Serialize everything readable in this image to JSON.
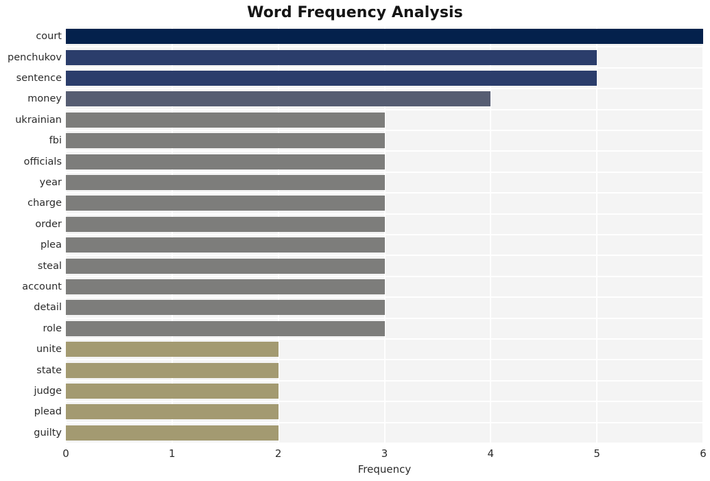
{
  "chart_data": {
    "type": "bar",
    "orientation": "horizontal",
    "title": "Word Frequency Analysis",
    "xlabel": "Frequency",
    "ylabel": "",
    "categories": [
      "court",
      "penchukov",
      "sentence",
      "money",
      "ukrainian",
      "fbi",
      "officials",
      "year",
      "charge",
      "order",
      "plea",
      "steal",
      "account",
      "detail",
      "role",
      "unite",
      "state",
      "judge",
      "plead",
      "guilty"
    ],
    "values": [
      6,
      5,
      5,
      4,
      3,
      3,
      3,
      3,
      3,
      3,
      3,
      3,
      3,
      3,
      3,
      2,
      2,
      2,
      2,
      2
    ],
    "bar_colors": [
      "#04214c",
      "#2b3d6b",
      "#2b3d6b",
      "#565d72",
      "#7d7d7b",
      "#7d7d7b",
      "#7d7d7b",
      "#7d7d7b",
      "#7d7d7b",
      "#7d7d7b",
      "#7d7d7b",
      "#7d7d7b",
      "#7d7d7b",
      "#7d7d7b",
      "#7d7d7b",
      "#a39a71",
      "#a39a71",
      "#a39a71",
      "#a39a71",
      "#a39a71"
    ],
    "xticks": [
      0,
      1,
      2,
      3,
      4,
      5,
      6
    ],
    "xtick_labels": [
      "0",
      "1",
      "2",
      "3",
      "4",
      "5",
      "6"
    ],
    "xlim": [
      0,
      6
    ],
    "grid": true,
    "legend": false,
    "plot_background": "#f4f4f4",
    "grid_color": "#ffffff",
    "figure_background": "#ffffff"
  }
}
